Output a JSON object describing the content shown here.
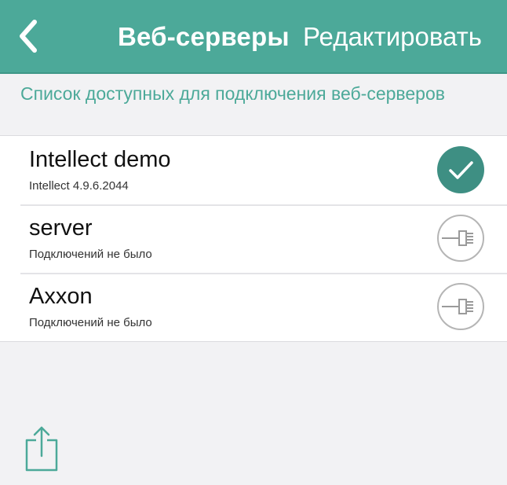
{
  "nav": {
    "back_icon": "chevron-left-icon",
    "title": "Веб-серверы",
    "edit_label": "Редактировать",
    "bg_color": "#4ca999"
  },
  "section": {
    "header": "Список доступных для подключения веб-серверов"
  },
  "servers": [
    {
      "name": "Intellect demo",
      "subtitle": "Intellect 4.9.6.2044",
      "status_icon": "checkmark-circle-icon"
    },
    {
      "name": "server",
      "subtitle": "Подключений не было",
      "status_icon": "plug-connect-icon"
    },
    {
      "name": "Axxon",
      "subtitle": "Подключений не было",
      "status_icon": "plug-connect-icon"
    }
  ],
  "toolbar": {
    "share_icon": "share-icon"
  },
  "colors": {
    "accent": "#4ca999",
    "background": "#f2f2f4",
    "list_bg": "#ffffff"
  }
}
